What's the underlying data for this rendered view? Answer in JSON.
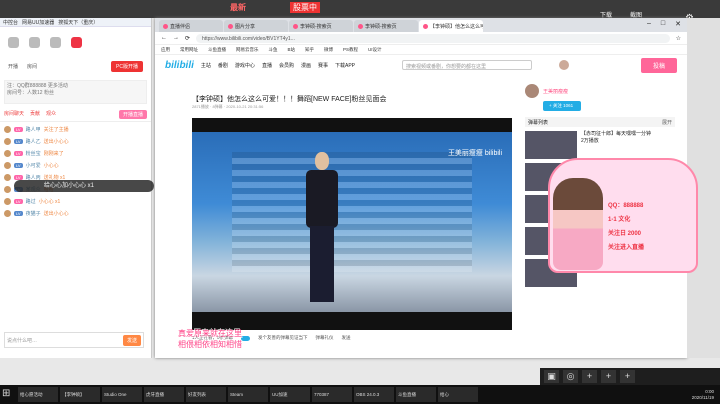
{
  "topbar": {
    "mid_a": "最新",
    "mid_b": "股票中",
    "right_a": "下载",
    "right_b": "截图"
  },
  "left": {
    "title_a": "中控台",
    "title_b": "网易UU加速器",
    "title_c": "搜狐天下（重庆）",
    "btn_a": "开播",
    "btn_b": "房间",
    "btn_live": "PC版开播",
    "info_a": "注：QQ群888888 更多活动",
    "info_b": "房间号：人数12 粉丝",
    "tab_a": "房间聊天",
    "tab_b": "贡献",
    "tab_c": "观众",
    "tab_btn": "开播直播",
    "send": "发送",
    "chat": [
      {
        "name": "路人甲",
        "msg": "关注了主播"
      },
      {
        "name": "路人乙",
        "msg": "送出小心心"
      },
      {
        "name": "粉丝宝",
        "msg": "刚刚来了"
      },
      {
        "name": "小可爱",
        "msg": "小心心"
      },
      {
        "name": "路人丙",
        "msg": "送礼物 x1"
      },
      {
        "name": "某观众",
        "msg": "哈哈"
      },
      {
        "name": "路过",
        "msg": "小心心 x1"
      },
      {
        "name": "夜猫子",
        "msg": "送出小心心"
      }
    ],
    "dark_bubble": "给心心加小心心 x1",
    "input_ph": "说点什么吧…"
  },
  "browser": {
    "tabs": [
      "直播伴侣",
      "图片分享",
      "李钟硕-搜索页",
      "李钟硕-搜索页",
      "【李钟硕】他怎么这么可爱"
    ],
    "url": "https://www.bilibili.com/video/BV1YT4y1...",
    "bookmarks": [
      "应用",
      "常用网址",
      "斗鱼直播",
      "网易云音乐",
      "斗鱼",
      "B站",
      "知乎",
      "微博",
      "PS教程",
      "UI设计"
    ],
    "nav": [
      "主站",
      "番剧",
      "游戏中心",
      "直播",
      "会员购",
      "漫画",
      "赛事",
      "下载APP"
    ],
    "search_ph": "搜索视频或番剧，你想要的都在这里",
    "upload": "投稿",
    "video_title": "【李钟硕】他怎么这么可爱！！！舞蹈[NEW FACE]粉丝见面会",
    "video_meta": "2871播放 · 8弹幕 · 2020-10-21 20:31:56",
    "watermark": "王美丽瘦瘦 bilibili",
    "ctrl_a": "1人正在看，0条弹幕",
    "ctrl_b": "发个友善的弹幕见证当下",
    "ctrl_c": "弹幕礼仪",
    "ctrl_d": "发送",
    "up_name": "王美丽瘦瘦",
    "follow": "+ 关注 1061",
    "pl_head": "弹幕列表",
    "pl_right": "展开",
    "items": [
      {
        "t": "【赤司征十郎】每天嘿嘿一分钟",
        "s": "2万播放"
      },
      {
        "t": "鬼畜全明星 怎么说",
        "s": "1万播放"
      },
      {
        "t": "冲冲冲 新春",
        "s": "9千播放"
      },
      {
        "t": "高能美男生在不同…",
        "s": "1万播放"
      },
      {
        "t": "【李钟硕】他可以 02-二",
        "s": "5千播放"
      }
    ]
  },
  "overlay": {
    "lines": [
      "QQ：888888",
      "1-1 文化",
      "关注日 2000",
      "关注进入直播"
    ],
    "subs_a": "真爱原来就在这里",
    "subs_b": "相偎相依相知相惜"
  },
  "dock": [
    "▣",
    "◎",
    "+",
    "+",
    "+"
  ],
  "taskbar": {
    "items": [
      "给心愿活动",
      "【李钟硕】",
      "Studio One",
      "虎牙直播",
      "好友列表",
      "Steam",
      "UU加速",
      "770387",
      "OBS 24.0.3",
      "斗鱼直播",
      "给心"
    ],
    "time": "0:00",
    "date": "2020/11/19"
  }
}
